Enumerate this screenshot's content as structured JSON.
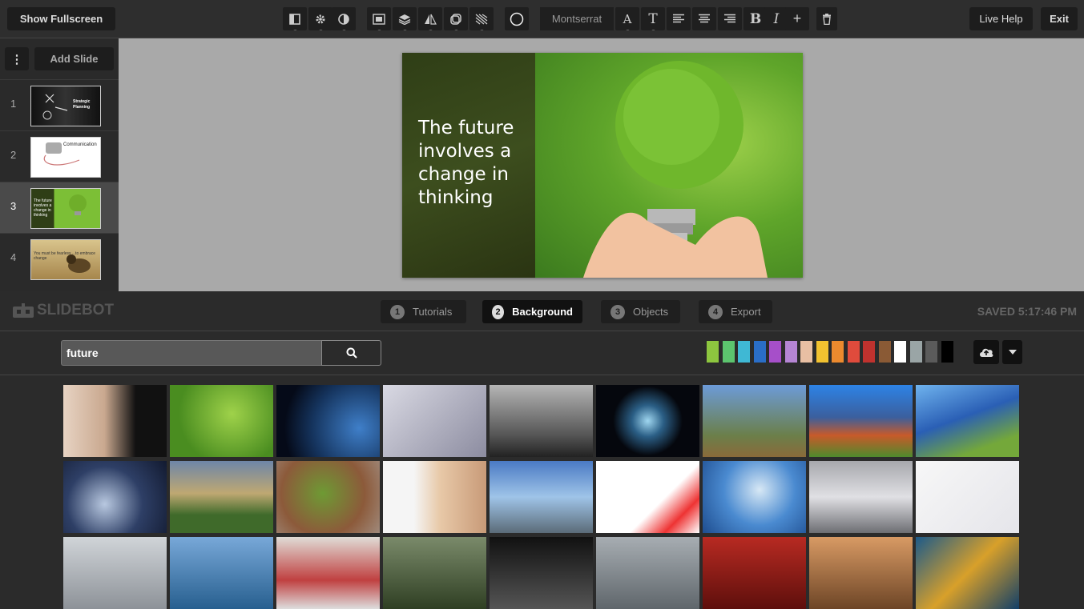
{
  "toolbar": {
    "fullscreen_label": "Show Fullscreen",
    "font_name": "Montserrat",
    "live_help_label": "Live Help",
    "exit_label": "Exit",
    "bold_label": "B",
    "italic_label": "I",
    "plus_label": "+",
    "text_size_label": "T",
    "font_style_label": "A"
  },
  "sidebar": {
    "menu_label": "⋮",
    "add_slide_label": "Add Slide",
    "slides": [
      {
        "number": "1",
        "thumb_text": "Strategic Planning"
      },
      {
        "number": "2",
        "thumb_text": "Communication"
      },
      {
        "number": "3",
        "thumb_text": "The future involves a change in thinking"
      },
      {
        "number": "4",
        "thumb_text": "You must be fearless ...to embrace change"
      }
    ],
    "active_slide": 3
  },
  "slide": {
    "text": "The future involves a change in thinking"
  },
  "midbar": {
    "logo_text": "SLIDEBOT",
    "tabs": [
      {
        "num": "1",
        "label": "Tutorials"
      },
      {
        "num": "2",
        "label": "Background"
      },
      {
        "num": "3",
        "label": "Objects"
      },
      {
        "num": "4",
        "label": "Export"
      }
    ],
    "active_tab": "Background",
    "saved_text": "SAVED 5:17:46 PM"
  },
  "search": {
    "value": "future"
  },
  "colors": {
    "swatches": [
      "#8dc63f",
      "#5cc46e",
      "#3fb8d4",
      "#2a6ec7",
      "#a64fc9",
      "#b585d4",
      "#e8bfa3",
      "#f2c230",
      "#ec8a2e",
      "#e04b3c",
      "#c0322e",
      "#8a5a35",
      "#ffffff",
      "#9aa5a6",
      "#5b5b5b",
      "#000000"
    ]
  },
  "images": [
    {
      "name": "pregnant-belly",
      "bg": "linear-gradient(90deg,#e7d3c3 0%,#c9a88f 40%,#111 70%)"
    },
    {
      "name": "green-lightbulb",
      "bg": "radial-gradient(circle at 60% 40%,#9fd24a,#4a8d20 70%)"
    },
    {
      "name": "earth-space",
      "bg": "radial-gradient(circle at 80% 60%,#3f7fc9,#15345e 50%,#050a18 80%)"
    },
    {
      "name": "futuristic-chair",
      "bg": "linear-gradient(135deg,#d9d9e3,#8c8ca0)"
    },
    {
      "name": "city-skyline",
      "bg": "linear-gradient(180deg,#b5b5b5,#555 70%,#222)"
    },
    {
      "name": "glowing-orb",
      "bg": "radial-gradient(circle at 50% 50%,#9fd6f0,#2b5f86 25%,#05070d 55%)"
    },
    {
      "name": "glass-dome",
      "bg": "linear-gradient(180deg,#6c9bd8,#6b7f4a 70%,#8a6a3a)"
    },
    {
      "name": "solar-house",
      "bg": "linear-gradient(180deg,#2d83e6,#3b5f9d 45%,#c85a2a 70%,#4f8a2c)"
    },
    {
      "name": "solar-panels-field",
      "bg": "linear-gradient(160deg,#6fb3ee,#2a5fb5 45%,#74a83a 80%)"
    },
    {
      "name": "vision-compass",
      "bg": "radial-gradient(circle at 40% 60%,#b8c8e0,#2e3f66 50%,#121a30)"
    },
    {
      "name": "wind-turbines",
      "bg": "linear-gradient(180deg,#6e86a8,#bfa872 45%,#3f6a2a 75%)"
    },
    {
      "name": "tree-dome",
      "bg": "radial-gradient(circle at 45% 45%,#6e9a34,#8c5a3a 60%,#a08a7c)"
    },
    {
      "name": "man-drawing",
      "bg": "linear-gradient(90deg,#f5f5f5 30%,#e8c9a8 55%,#c89a78)"
    },
    {
      "name": "supertrees",
      "bg": "linear-gradient(180deg,#4a7ac4,#9fc4e8 50%,#5b6b78)"
    },
    {
      "name": "risk-diagram",
      "bg": "linear-gradient(135deg,#ffffff 60%,#e33 80%,#fff)"
    },
    {
      "name": "crystal-ball",
      "bg": "radial-gradient(circle at 55% 40%,#d7e8f5,#4a8ad0 50%,#1e4d8f)"
    },
    {
      "name": "concept-car",
      "bg": "linear-gradient(180deg,#a7a8ad,#e0e0e4 50%,#6d6e73)"
    },
    {
      "name": "whiteboard-diagram",
      "bg": "linear-gradient(135deg,#f7f7f7,#e5e5ea)"
    },
    {
      "name": "industrial",
      "bg": "linear-gradient(180deg,#d0d4d8,#8d9298)"
    },
    {
      "name": "sea-boats",
      "bg": "linear-gradient(180deg,#78a8d8,#275f8f)"
    },
    {
      "name": "red-hands-wall",
      "bg": "linear-gradient(180deg,#e0dcd6,#c04040 60%,#ddd)"
    },
    {
      "name": "forest-path",
      "bg": "linear-gradient(180deg,#7a8a6a,#2f3f23)"
    },
    {
      "name": "dark-text-sign",
      "bg": "linear-gradient(180deg,#111,#555)"
    },
    {
      "name": "misty-trees",
      "bg": "linear-gradient(180deg,#a7adb2,#5f666b)"
    },
    {
      "name": "red-sports-car",
      "bg": "linear-gradient(180deg,#b82a22,#5e0f0c)"
    },
    {
      "name": "horned-bull",
      "bg": "linear-gradient(180deg,#d89a64,#6d4526)"
    },
    {
      "name": "coral-fish",
      "bg": "linear-gradient(135deg,#1c5a8a,#d8a02a 50%,#123f68)"
    }
  ]
}
